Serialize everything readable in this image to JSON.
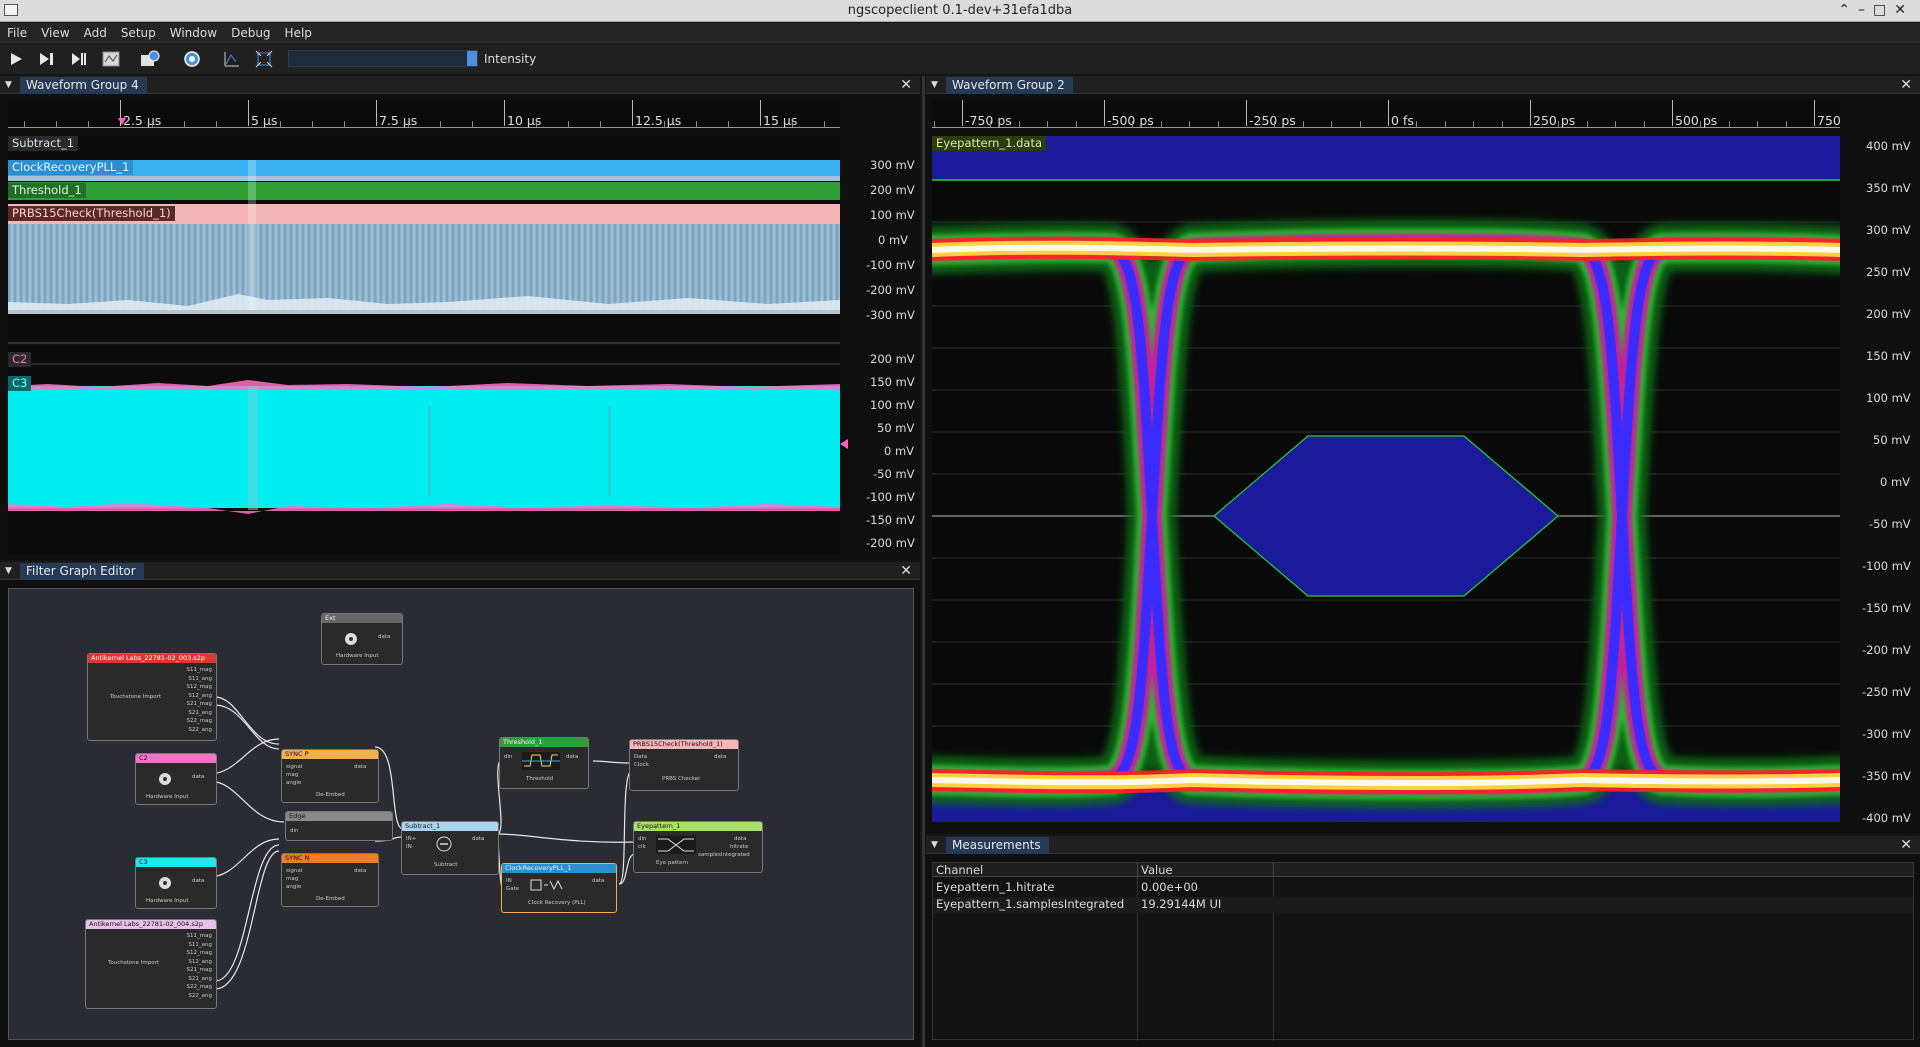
{
  "window": {
    "title": "ngscopeclient 0.1-dev+31efa1dba",
    "buttons": [
      "⌃",
      "–",
      "□",
      "✕"
    ]
  },
  "menu": [
    "File",
    "View",
    "Add",
    "Setup",
    "Window",
    "Debug",
    "Help"
  ],
  "toolbar": {
    "intensity_label": "Intensity",
    "intensity_level": 1.0
  },
  "waveform_group_4": {
    "tab": "Waveform Group 4",
    "close": "✕",
    "time_ticks": [
      "2.5 µs",
      "5 µs",
      "7.5 µs",
      "10 µs",
      "12.5 µs",
      "15 µs"
    ],
    "area1": {
      "channels": [
        "Subtract_1",
        "ClockRecoveryPLL_1",
        "Threshold_1",
        "PRBS15Check(Threshold_1)"
      ],
      "y_ticks": [
        "300 mV",
        "200 mV",
        "100 mV",
        "0 mV",
        "-100 mV",
        "-200 mV",
        "-300 mV"
      ]
    },
    "area2": {
      "channels": [
        "C2",
        "C3"
      ],
      "y_ticks": [
        "200 mV",
        "150 mV",
        "100 mV",
        "50 mV",
        "0 mV",
        "-50 mV",
        "-100 mV",
        "-150 mV",
        "-200 mV"
      ]
    }
  },
  "waveform_group_2": {
    "tab": "Waveform Group 2",
    "close": "✕",
    "time_ticks": [
      "-750 ps",
      "-500 ps",
      "-250 ps",
      "0 fs",
      "250 ps",
      "500 ps",
      "750"
    ],
    "channel": "Eyepattern_1.data",
    "y_ticks": [
      "400 mV",
      "350 mV",
      "300 mV",
      "250 mV",
      "200 mV",
      "150 mV",
      "100 mV",
      "50 mV",
      "0 mV",
      "-50 mV",
      "-100 mV",
      "-150 mV",
      "-200 mV",
      "-250 mV",
      "-300 mV",
      "-350 mV",
      "-400 mV"
    ]
  },
  "filter_graph": {
    "tab": "Filter Graph Editor",
    "close": "✕",
    "nodes": {
      "ext": {
        "title": "Ext",
        "body": "Hardware Input",
        "port_out": "data"
      },
      "touchstone1": {
        "title": "Antikernel Labs_22781-02_003.s2p",
        "body": "Touchstone Import",
        "ports": [
          "S11_mag",
          "S11_ang",
          "S12_mag",
          "S12_ang",
          "S21_mag",
          "S21_ang",
          "S22_mag",
          "S22_ang"
        ]
      },
      "c2": {
        "title": "C2",
        "body": "Hardware Input",
        "port_out": "data"
      },
      "syncp": {
        "title": "SYNC P",
        "body": "De-Embed",
        "ports_in": [
          "signal",
          "mag",
          "angle"
        ],
        "port_out": "data"
      },
      "edge": {
        "title": "Edge",
        "port_in": "din"
      },
      "c3": {
        "title": "C3",
        "body": "Hardware Input",
        "port_out": "data"
      },
      "syncn": {
        "title": "SYNC N",
        "body": "De-Embed",
        "ports_in": [
          "signal",
          "mag",
          "angle"
        ],
        "port_out": "data"
      },
      "touchstone2": {
        "title": "Antikernel Labs_22781-02_004.s2p",
        "body": "Touchstone Import",
        "ports": [
          "S11_mag",
          "S11_ang",
          "S12_mag",
          "S12_ang",
          "S21_mag",
          "S21_ang",
          "S22_mag",
          "S22_ang"
        ]
      },
      "subtract": {
        "title": "Subtract_1",
        "body": "Subtract",
        "ports_in": [
          "IN+",
          "IN-"
        ],
        "port_out": "data"
      },
      "threshold": {
        "title": "Threshold_1",
        "body": "Threshold",
        "port_in": "din",
        "port_out": "data"
      },
      "prbs": {
        "title": "PRBS15Check(Threshold_1)",
        "body": "PRBS Checker",
        "ports_in": [
          "Data",
          "Clock"
        ],
        "port_out": "data"
      },
      "eye": {
        "title": "Eyepattern_1",
        "body": "Eye pattern",
        "ports_in": [
          "din",
          "clk"
        ],
        "ports_out": [
          "data",
          "hitrate",
          "samplesIntegrated"
        ]
      },
      "cdr": {
        "title": "ClockRecoveryPLL_1",
        "body": "Clock Recovery (PLL)",
        "ports_in": [
          "IN",
          "Gate"
        ],
        "port_out": "data"
      }
    }
  },
  "measurements": {
    "tab": "Measurements",
    "close": "✕",
    "columns": [
      "Channel",
      "Value"
    ],
    "rows": [
      {
        "channel": "Eyepattern_1.hitrate",
        "value": "0.00e+00"
      },
      {
        "channel": "Eyepattern_1.samplesIntegrated",
        "value": "19.29144M UI"
      }
    ]
  },
  "colors": {
    "subtract": "#9ec4de",
    "clock_recovery": "#39b0f0",
    "threshold": "#2e9e35",
    "prbs": "#f4b6b6",
    "c2": "#ff70c8",
    "c3": "#00f0f0",
    "eye_mask": "#1a1a9a",
    "eye_mask_border": "#2bd02b",
    "tab_bg": "#243a55"
  }
}
